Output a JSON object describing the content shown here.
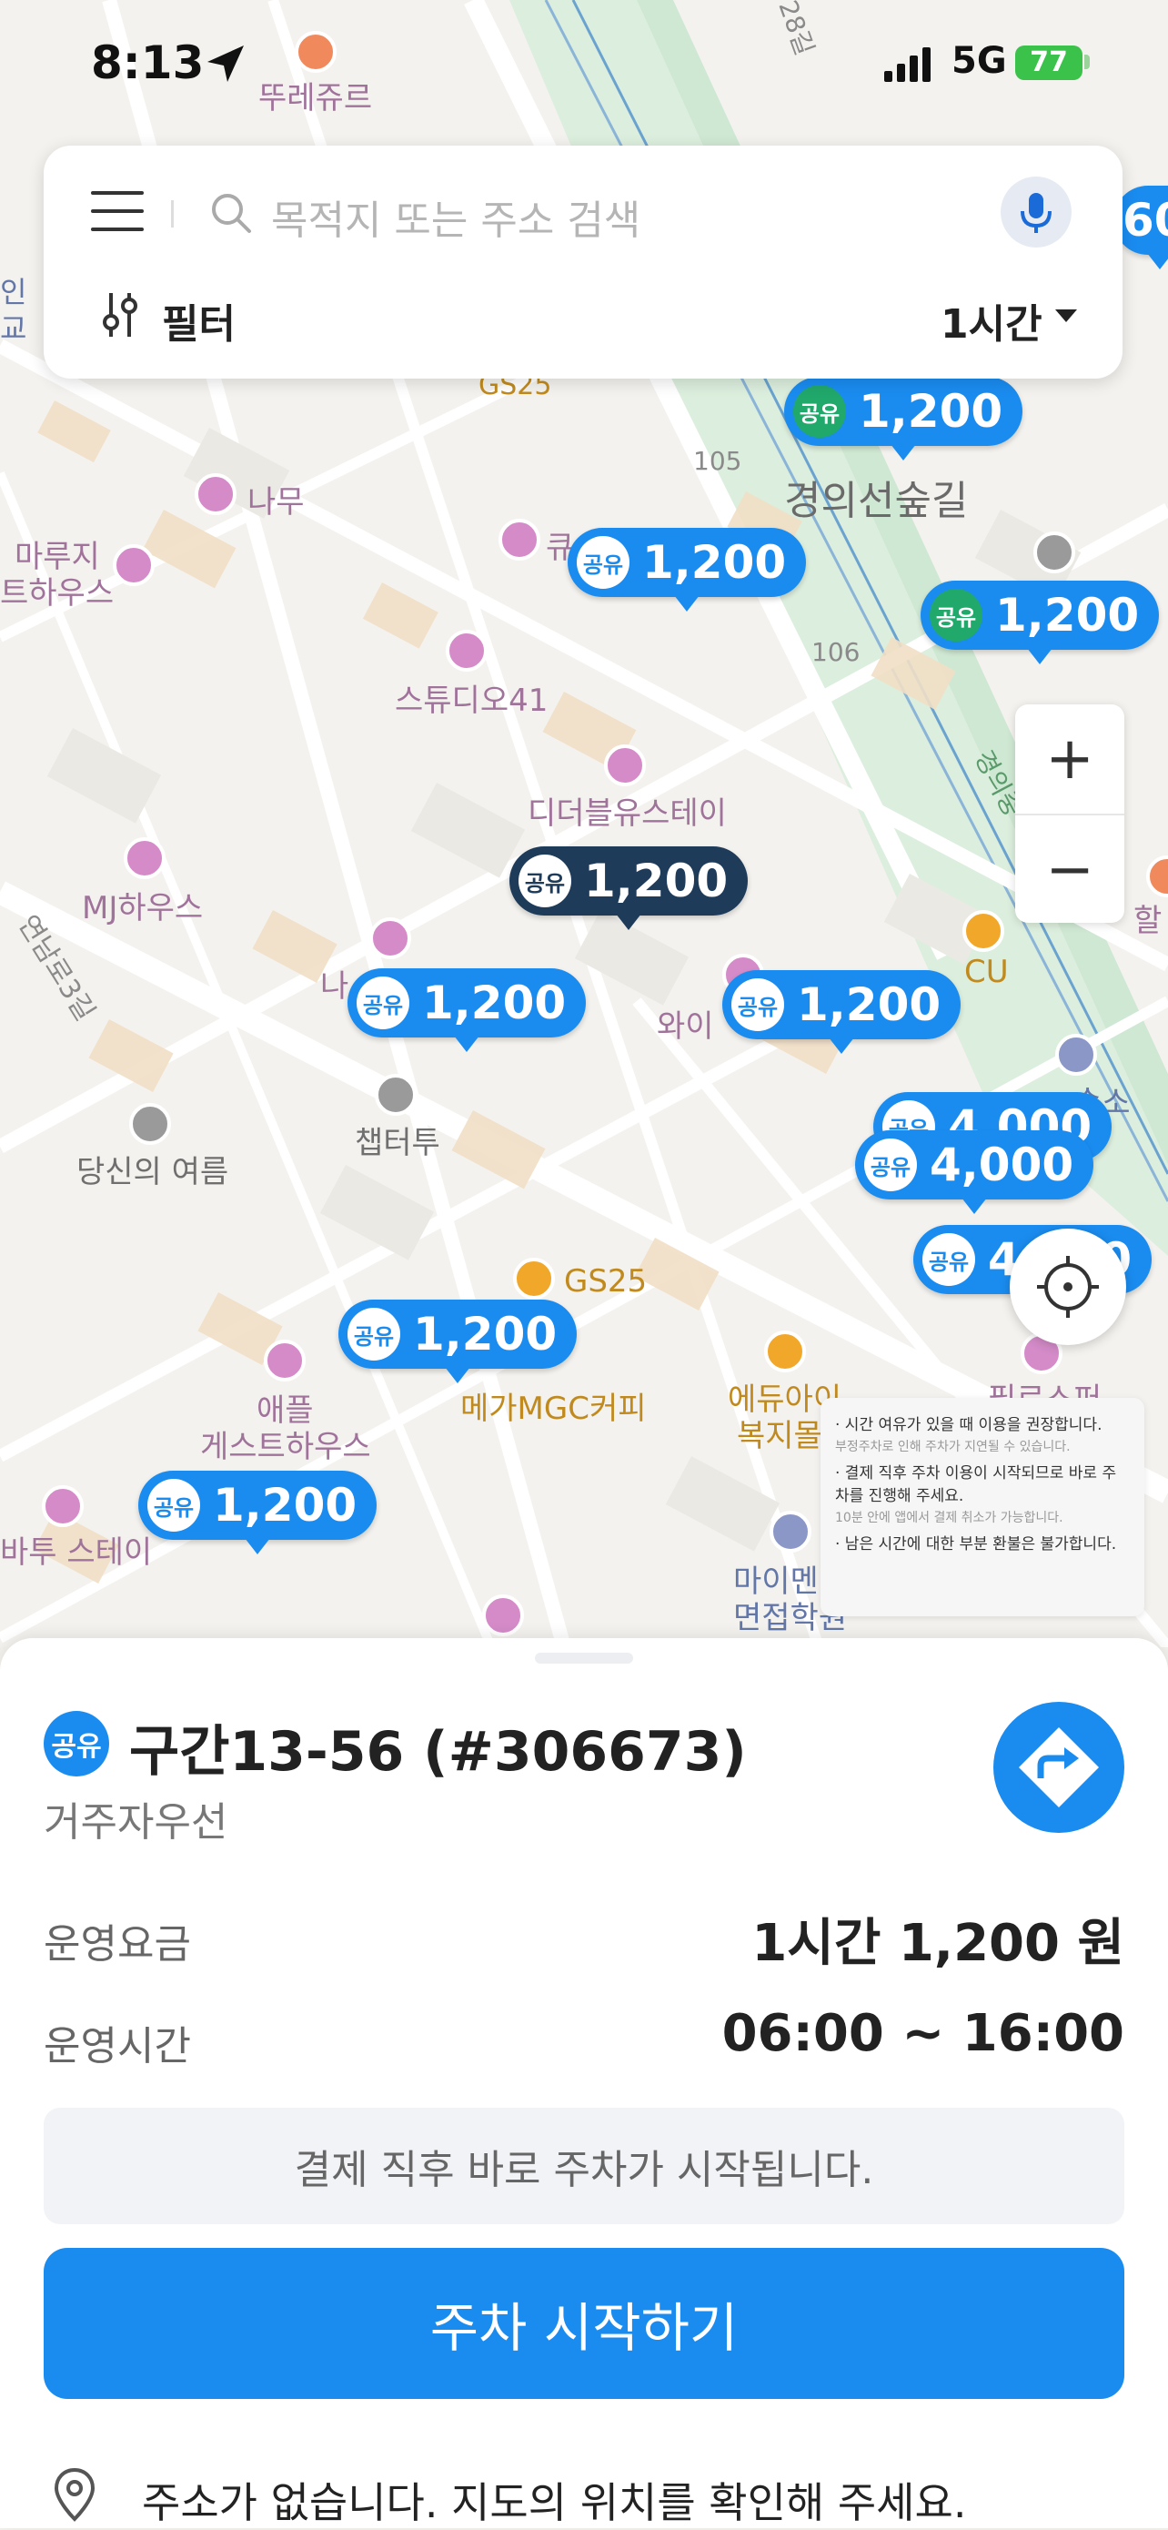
{
  "status_bar": {
    "time": "8:13",
    "network": "5G",
    "battery": "77"
  },
  "search": {
    "placeholder": "목적지 또는 주소 검색",
    "filter_label": "필터",
    "time_select": "1시간"
  },
  "map": {
    "pois": [
      {
        "label": "뚜레쥬르",
        "style": "p-pink"
      },
      {
        "label": "나무",
        "style": "p-pink"
      },
      {
        "label": "마루지",
        "style": "p-pink"
      },
      {
        "label": "트하우스",
        "style": "p-pink"
      },
      {
        "label": "스튜디오41",
        "style": "p-pink"
      },
      {
        "label": "디더블유스테이",
        "style": "p-pink"
      },
      {
        "label": "MJ하우스",
        "style": "p-pink"
      },
      {
        "label": "챕터투",
        "style": "p-gray"
      },
      {
        "label": "당신의 여름",
        "style": "p-gray"
      },
      {
        "label": "CU",
        "style": "p-gold"
      },
      {
        "label": "GS25",
        "style": "p-gold"
      },
      {
        "label": "GS25",
        "style": "p-gold"
      },
      {
        "label": "메가MGC커피",
        "style": "p-gold"
      },
      {
        "label": "에듀아이",
        "style": "p-gold"
      },
      {
        "label": "복지몰",
        "style": "p-gold"
      },
      {
        "label": "애플",
        "style": "p-pink"
      },
      {
        "label": "게스트하우스",
        "style": "p-pink"
      },
      {
        "label": "바투 스테이",
        "style": "p-pink"
      },
      {
        "label": "마이멘",
        "style": "p-blue"
      },
      {
        "label": "면접학원",
        "style": "p-blue"
      },
      {
        "label": "와이",
        "style": "p-pink"
      },
      {
        "label": "나",
        "style": "p-pink"
      },
      {
        "label": "필로스퍼",
        "style": "p-pink"
      },
      {
        "label": "할",
        "style": "p-pink"
      },
      {
        "label": "인",
        "style": "p-blue"
      },
      {
        "label": "교",
        "style": "p-blue"
      },
      {
        "label": "숙소",
        "style": "p-blue"
      },
      {
        "label": "큐",
        "style": "p-pink"
      }
    ],
    "roads": [
      {
        "label": "경의선숲길",
        "big": true
      },
      {
        "label": "105",
        "big": false
      },
      {
        "label": "106",
        "big": false
      },
      {
        "label": "28길",
        "big": false
      },
      {
        "label": "연남로3길",
        "big": false
      },
      {
        "label": "경의중",
        "big": false
      }
    ],
    "markers": [
      {
        "badge": "공유",
        "price": "1,200",
        "variant": "green"
      },
      {
        "badge": "공유",
        "price": "1,200",
        "variant": ""
      },
      {
        "badge": "공유",
        "price": "1,200",
        "variant": "green"
      },
      {
        "badge": "공유",
        "price": "1,200",
        "variant": "dark"
      },
      {
        "badge": "공유",
        "price": "1,200",
        "variant": ""
      },
      {
        "badge": "공유",
        "price": "1,200",
        "variant": ""
      },
      {
        "badge": "공유",
        "price": "4,000",
        "variant": ""
      },
      {
        "badge": "공유",
        "price": "4,000",
        "variant": ""
      },
      {
        "badge": "공유",
        "price": "4,000",
        "variant": ""
      },
      {
        "badge": "공유",
        "price": "1,200",
        "variant": ""
      },
      {
        "badge": "공유",
        "price": "1,200",
        "variant": ""
      },
      {
        "badge": "",
        "price": "60",
        "variant": ""
      }
    ],
    "zoom_in": "+",
    "zoom_out": "−"
  },
  "notice": {
    "items": [
      {
        "text": "· 시간 여유가 있을 때 이용을 권장합니다.",
        "sub": "부정주차로 인해 주차가 지연될 수 있습니다."
      },
      {
        "text": "· 결제 직후 주차 이용이 시작되므로 바로 주차를 진행해 주세요.",
        "sub": "10분 안에 앱에서 결제 취소가 가능합니다."
      },
      {
        "text": "· 남은 시간에 대한 부분 환불은 불가합니다.",
        "sub": ""
      }
    ]
  },
  "sheet": {
    "badge": "공유",
    "title": "구간13-56 (#306673)",
    "subtitle": "거주자우선",
    "fee_label": "운영요금",
    "fee_value": "1시간 1,200 원",
    "hours_label": "운영시간",
    "hours_value": "06:00 ~ 16:00",
    "info_text": "결제 직후 바로 주차가 시작됩니다.",
    "start_button": "주차 시작하기",
    "address_text": "주소가 없습니다. 지도의 위치를 확인해 주세요."
  },
  "colors": {
    "accent": "#1a8cf0",
    "marker_dark": "#1f3b5a",
    "marker_green": "#21a86b"
  }
}
